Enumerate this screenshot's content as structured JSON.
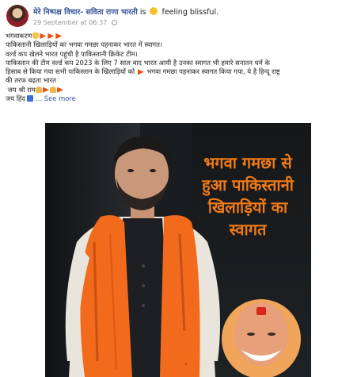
{
  "post": {
    "author": "मेरे निष्पक्ष विचार- सविता राणा भारती",
    "feeling_prefix": "is",
    "feeling": "feeling blissful.",
    "timestamp": "29 September at 06:37",
    "lines": [
      "भगवाकरण",
      "पाकिस्तानी खिलाड़ियों का भगवा गमछा पहनाकर भारत में स्वागत।",
      "वर्ल्ड कप खेलने भारत पहुंची है पाकिस्तानी क्रिकेट टीम।",
      "पाकिस्तान की टीम वर्ल्ड कप 2023 के लिए 7 साल बाद भारत आयी है उनका स्वागत भी हमारे सनातन धर्म के",
      "हिसाब से किया गया सभी पाकिस्तान के खिलाड़ियों को",
      "भगवा गमछा पहनाकर स्वागत किया गया, ये है हिन्दू राष्ट्र",
      "की तरफ बढ़ता भारत",
      "जय श्री राम",
      "जय हिंद"
    ],
    "see_more": "... See more"
  },
  "media": {
    "headline": [
      "भगवा गमछा से",
      "हुआ पाकिस्तानी",
      "खिलाड़ियों का",
      "स्वागत"
    ],
    "scarf_text": "स्वागत"
  },
  "colors": {
    "saffron": "#f07a18",
    "link": "#365899"
  }
}
